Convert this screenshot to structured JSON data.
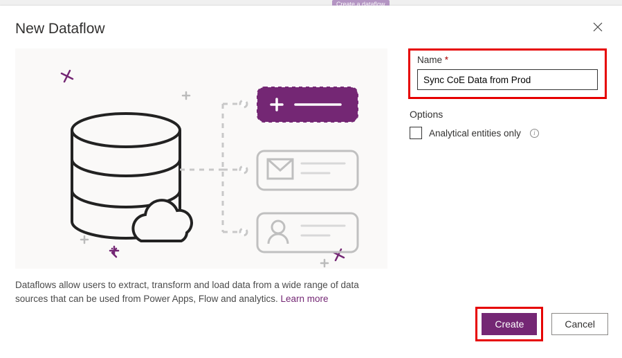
{
  "topHint": "Create a dataflow",
  "dialog": {
    "title": "New Dataflow",
    "description": "Dataflows allow users to extract, transform and load data from a wide range of data sources that can be used from Power Apps, Flow and analytics. ",
    "learnMore": "Learn more"
  },
  "form": {
    "nameLabel": "Name",
    "nameRequiredMark": "*",
    "nameValue": "Sync CoE Data from Prod",
    "optionsLabel": "Options",
    "analyticalLabel": "Analytical entities only"
  },
  "buttons": {
    "create": "Create",
    "cancel": "Cancel"
  }
}
